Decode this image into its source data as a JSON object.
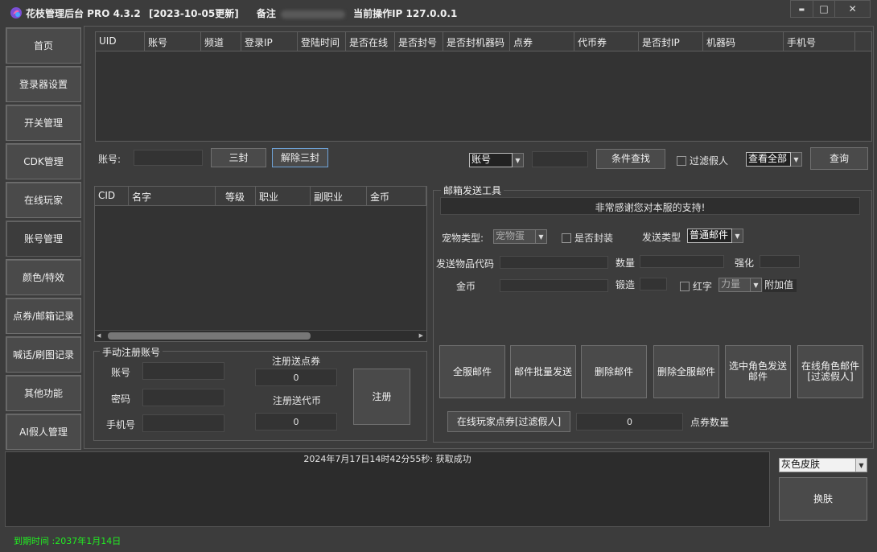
{
  "title": {
    "app_name": "花枝管理后台 PRO 4.3.2",
    "update_date": "[2023-10-05更新]",
    "note_label": "备注",
    "current_ip": "当前操作IP 127.0.0.1"
  },
  "window_buttons": {
    "minimize": "▬",
    "maximize": "□",
    "close": "✕"
  },
  "sidebar": [
    {
      "label": "首页"
    },
    {
      "label": "登录器设置"
    },
    {
      "label": "开关管理"
    },
    {
      "label": "CDK管理"
    },
    {
      "label": "在线玩家"
    },
    {
      "label": "账号管理"
    },
    {
      "label": "颜色/特效"
    },
    {
      "label": "点券/邮箱记录"
    },
    {
      "label": "喊话/刷图记录"
    },
    {
      "label": "其他功能"
    },
    {
      "label": "AI假人管理"
    }
  ],
  "account_table": {
    "columns": [
      "UID",
      "账号",
      "频道",
      "登录IP",
      "登陆时间",
      "是否在线",
      "是否封号",
      "是否封机器码",
      "点券",
      "代币券",
      "是否封IP",
      "机器码",
      "手机号"
    ]
  },
  "account_actions": {
    "account_label": "账号:",
    "account_value": "",
    "ban_button": "三封",
    "unban_button": "解除三封",
    "filter_select": "账号",
    "filter_value": "",
    "condition_search": "条件查找",
    "filter_fake_label": "过滤假人",
    "view_select": "查看全部",
    "query_button": "查询"
  },
  "character_table": {
    "columns": [
      "CID",
      "名字",
      "等级",
      "职业",
      "副职业",
      "金币"
    ]
  },
  "manual_register": {
    "group_title": "手动注册账号",
    "account_label": "账号",
    "password_label": "密码",
    "phone_label": "手机号",
    "bonus_points_label": "注册送点券",
    "bonus_points_value": "0",
    "bonus_coins_label": "注册送代币",
    "bonus_coins_value": "0",
    "register_button": "注册"
  },
  "mail_tool": {
    "group_title": "邮箱发送工具",
    "banner": "非常感谢您对本服的支持!",
    "pet_type_label": "宠物类型:",
    "pet_type_value": "宠物蛋",
    "sealed_label": "是否封装",
    "send_type_label": "发送类型",
    "send_type_value": "普通邮件",
    "item_code_label": "发送物品代码",
    "quantity_label": "数量",
    "enhance_label": "强化",
    "gold_label": "金币",
    "forge_label": "锻造",
    "red_label": "红字",
    "stat_value": "力量",
    "extra_label": "附加值",
    "buttons": [
      {
        "label": "全服邮件"
      },
      {
        "label": "邮件批量发送"
      },
      {
        "label": "删除邮件"
      },
      {
        "label": "删除全服邮件"
      },
      {
        "label": "选中角色发送邮件"
      },
      {
        "label": "在线角色邮件[过滤假人]"
      }
    ],
    "online_points_button": "在线玩家点券[过滤假人]",
    "points_amount_value": "0",
    "points_amount_label": "点券数量"
  },
  "log": {
    "message": "2024年7月17日14时42分55秒: 获取成功"
  },
  "skin": {
    "select_value": "灰色皮肤",
    "change_button": "换肤"
  },
  "status_bar": {
    "expiry": "到期时间 :2037年1月14日"
  },
  "colors": {
    "background": "#3c3c3c",
    "expiry_text": "#22ee22"
  }
}
